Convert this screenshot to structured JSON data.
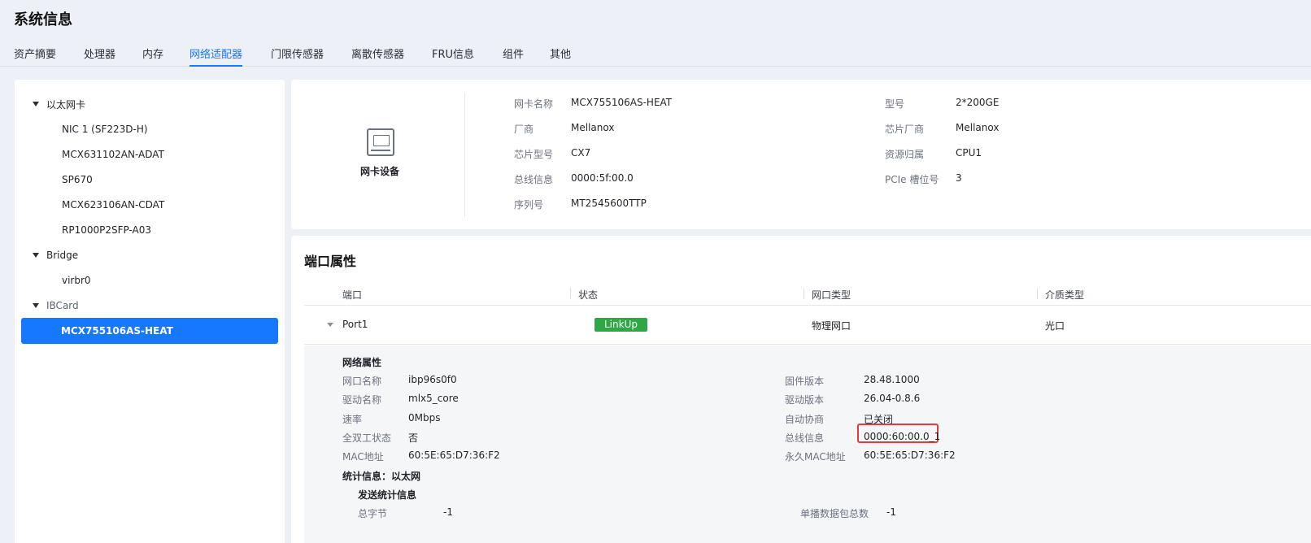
{
  "page": {
    "title": "系统信息"
  },
  "tabs": [
    {
      "label": "资产摘要"
    },
    {
      "label": "处理器"
    },
    {
      "label": "内存"
    },
    {
      "label": "网络适配器",
      "active": true
    },
    {
      "label": "门限传感器"
    },
    {
      "label": "离散传感器"
    },
    {
      "label": "FRU信息"
    },
    {
      "label": "组件"
    },
    {
      "label": "其他"
    }
  ],
  "tree": {
    "groups": [
      {
        "label": "以太网卡",
        "items": [
          "NIC 1 (SF223D-H)",
          "MCX631102AN-ADAT",
          "SP670",
          "MCX623106AN-CDAT",
          "RP1000P2SFP-A03"
        ]
      },
      {
        "label": "Bridge",
        "items": [
          "virbr0"
        ]
      },
      {
        "label": "IBCard",
        "items": [
          "MCX755106AS-HEAT"
        ]
      }
    ]
  },
  "device": {
    "label": "网卡设备",
    "left_fields": [
      {
        "label": "网卡名称",
        "value": "MCX755106AS-HEAT"
      },
      {
        "label": "厂商",
        "value": "Mellanox"
      },
      {
        "label": "芯片型号",
        "value": "CX7"
      },
      {
        "label": "总线信息",
        "value": "0000:5f:00.0"
      },
      {
        "label": "序列号",
        "value": "MT2545600TTP"
      }
    ],
    "right_fields": [
      {
        "label": "型号",
        "value": "2*200GE"
      },
      {
        "label": "芯片厂商",
        "value": "Mellanox"
      },
      {
        "label": "资源归属",
        "value": "CPU1"
      },
      {
        "label": "PCIe 槽位号",
        "value": "3"
      }
    ]
  },
  "ports": {
    "title": "端口属性",
    "columns": [
      "端口",
      "状态",
      "网口类型",
      "介质类型"
    ],
    "rows": [
      {
        "port": "Port1",
        "status": "LinkUp",
        "type": "物理网口",
        "media": "光口"
      }
    ],
    "detail": {
      "network_title": "网络属性",
      "left": [
        {
          "label": "网口名称",
          "value": "ibp96s0f0"
        },
        {
          "label": "驱动名称",
          "value": "mlx5_core"
        },
        {
          "label": "速率",
          "value": "0Mbps"
        },
        {
          "label": "全双工状态",
          "value": "否"
        },
        {
          "label": "MAC地址",
          "value": "60:5E:65:D7:36:F2"
        }
      ],
      "right": [
        {
          "label": "固件版本",
          "value": "28.48.1000"
        },
        {
          "label": "驱动版本",
          "value": "26.04-0.8.6"
        },
        {
          "label": "自动协商",
          "value": "已关闭"
        },
        {
          "label": "总线信息",
          "value": "0000:60:00.0_1"
        },
        {
          "label": "永久MAC地址",
          "value": "60:5E:65:D7:36:F2"
        }
      ],
      "stats_title": "统计信息：以太网",
      "tx_title": "发送统计信息",
      "tx": [
        {
          "label": "总字节",
          "value": "-1"
        },
        {
          "label": "单播数据包总数",
          "value": "-1"
        }
      ]
    }
  },
  "colors": {
    "accent": "#1677ff",
    "linkup": "#2ea842",
    "highlight": "#e23b3b"
  }
}
